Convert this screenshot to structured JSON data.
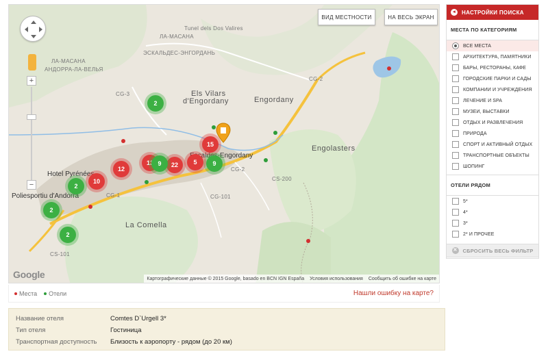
{
  "map": {
    "btn_terrain": "ВИД МЕСТНОСТИ",
    "btn_fullscreen": "НА ВЕСЬ ЭКРАН",
    "zoom_in": "+",
    "zoom_out": "−",
    "google_logo": "Google",
    "attribution": "Картографические данные © 2015 Google, basado en BCN IGN España",
    "terms": "Условия использования",
    "report_error": "Сообщить об ошибке на карте",
    "labels": {
      "tunel": "Tunel dels Dos Valires",
      "la_masana": "ЛА-МАСАНА",
      "andorra_la_vella": "АНДОРРА-ЛА-ВЕЛЬЯ",
      "escaldes": "ЭСКАЛЬДЕС-ЭНГОРДАНЬ",
      "la_masana_small": "ЛА-МАСАНА",
      "els_vilars": "Els Vilars",
      "d_engordany": "d'Engordany",
      "engordany": "Engordany",
      "engolasters": "Engolasters",
      "escaldes_map": "Escaldes-Engordany",
      "hotel_pyrenees": "Hotel Pyrénées",
      "poliesportiu": "Poliesportiu d'Andorra",
      "la_comella": "La Comella",
      "cg3": "CG-3",
      "cg2": "CG-2",
      "cg2b": "CG-2",
      "cg1": "CG-1",
      "cg101": "CG-101",
      "cs200": "CS-200",
      "cs101": "CS-101"
    },
    "clusters": [
      {
        "label": "2",
        "color": "green"
      },
      {
        "label": "15",
        "color": "red"
      },
      {
        "label": "9",
        "color": "green"
      },
      {
        "label": "5",
        "color": "red"
      },
      {
        "label": "22",
        "color": "red"
      },
      {
        "label": "13",
        "color": "red"
      },
      {
        "label": "9",
        "color": "green"
      },
      {
        "label": "12",
        "color": "red"
      },
      {
        "label": "10",
        "color": "red"
      },
      {
        "label": "2",
        "color": "green"
      },
      {
        "label": "2",
        "color": "green"
      },
      {
        "label": "2",
        "color": "green"
      }
    ]
  },
  "legend": {
    "places": "Места",
    "hotels": "Отели",
    "found_error": "Нашли ошибку на карте?"
  },
  "sidebar": {
    "title": "НАСТРОЙКИ ПОИСКА",
    "categories_title": "МЕСТА ПО КАТЕГОРИЯМ",
    "categories": [
      "ВСЕ МЕСТА",
      "АРХИТЕКТУРА, ПАМЯТНИКИ",
      "БАРЫ, РЕСТОРАНЫ, КАФЕ",
      "ГОРОДСКИЕ ПАРКИ И САДЫ",
      "КОМПАНИИ И УЧРЕЖДЕНИЯ",
      "ЛЕЧЕНИЕ И SPA",
      "МУЗЕИ, ВЫСТАВКИ",
      "ОТДЫХ И РАЗВЛЕЧЕНИЯ",
      "ПРИРОДА",
      "СПОРТ И АКТИВНЫЙ ОТДЫХ",
      "ТРАНСПОРТНЫЕ ОБЪЕКТЫ",
      "ШОПИНГ"
    ],
    "hotels_title": "ОТЕЛИ РЯДОМ",
    "hotels": [
      "5*",
      "4*",
      "3*",
      "2* И ПРОЧЕЕ"
    ],
    "reset": "СБРОСИТЬ ВЕСЬ ФИЛЬТР"
  },
  "info": {
    "name_label": "Название отеля",
    "name_value": "Comtes D`Urgell 3*",
    "type_label": "Тип отеля",
    "type_value": "Гостиница",
    "transport_label": "Транспортная доступность",
    "transport_value": "Близость к аэропорту - рядом (до 20 км)"
  },
  "colors": {
    "accent": "#c62828",
    "cluster_green": "#3cb043",
    "cluster_red": "#e03a3a",
    "info_bg": "#f5f0df"
  }
}
